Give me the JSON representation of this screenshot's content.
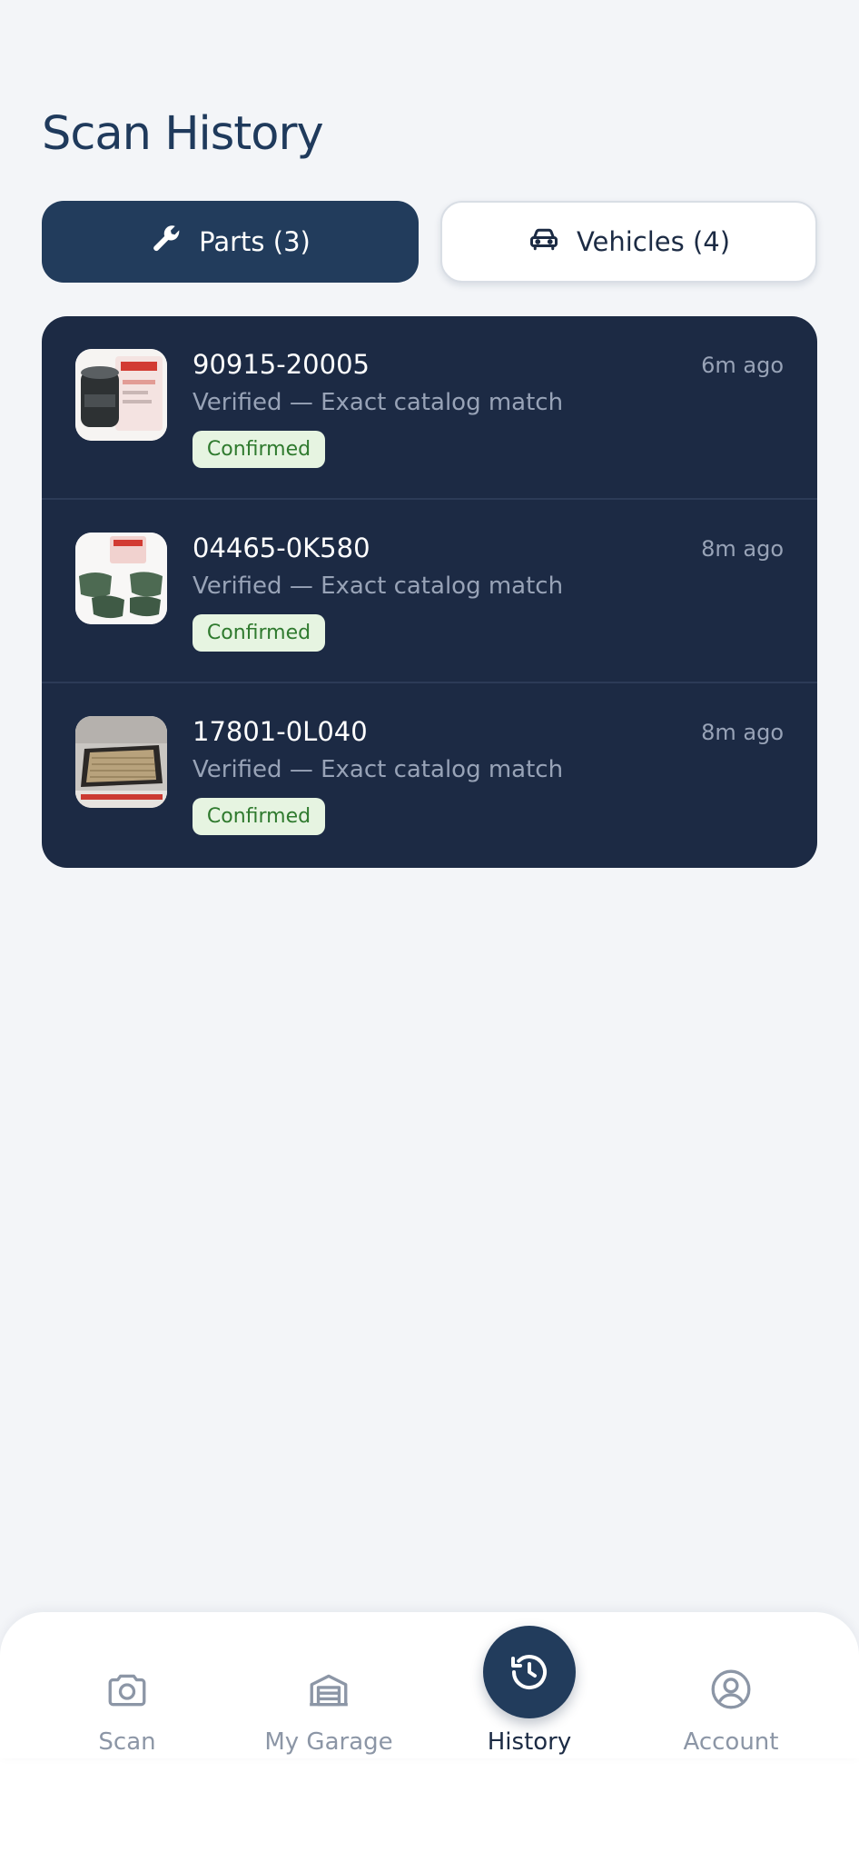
{
  "page": {
    "title": "Scan History"
  },
  "tabs": {
    "parts_label": "Parts (3)",
    "parts_icon": "wrench-icon",
    "vehicles_label": "Vehicles (4)",
    "vehicles_icon": "car-icon",
    "active": "parts"
  },
  "parts": [
    {
      "number": "90915-20005",
      "description": "Verified — Exact catalog match",
      "status": "Confirmed",
      "time": "6m ago",
      "thumbnail": "oil-filter-photo"
    },
    {
      "number": "04465-0K580",
      "description": "Verified — Exact catalog match",
      "status": "Confirmed",
      "time": "8m ago",
      "thumbnail": "brake-pads-photo"
    },
    {
      "number": "17801-0L040",
      "description": "Verified — Exact catalog match",
      "status": "Confirmed",
      "time": "8m ago",
      "thumbnail": "air-filter-photo"
    }
  ],
  "nav": {
    "items": [
      {
        "label": "Scan",
        "icon": "camera-icon"
      },
      {
        "label": "My Garage",
        "icon": "garage-icon"
      },
      {
        "label": "History",
        "icon": "history-icon"
      },
      {
        "label": "Account",
        "icon": "account-icon"
      }
    ],
    "active": "History"
  },
  "colors": {
    "primary": "#223c5c",
    "card_bg": "#1c2a44",
    "page_bg": "#f3f5f8",
    "badge_bg": "#e6f4e1",
    "badge_text": "#2f7a2e",
    "muted_text": "#98a3b7"
  }
}
